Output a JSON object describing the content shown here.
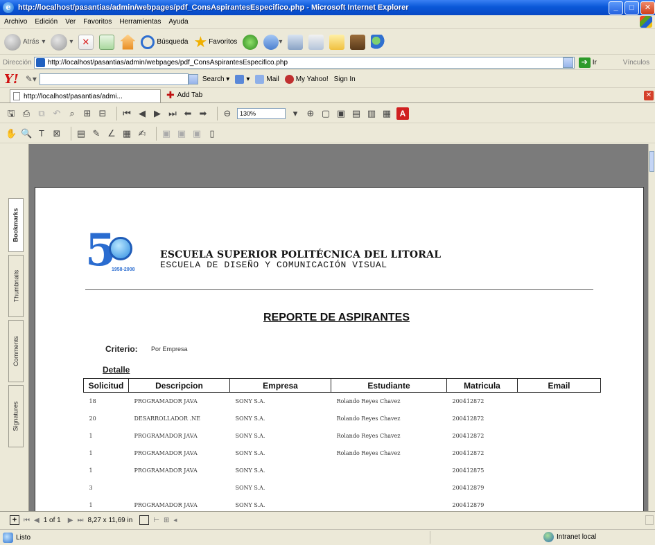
{
  "window": {
    "title": "http://localhost/pasantias/admin/webpages/pdf_ConsAspirantesEspecifico.php - Microsoft Internet Explorer"
  },
  "menu": [
    "Archivo",
    "Edición",
    "Ver",
    "Favoritos",
    "Herramientas",
    "Ayuda"
  ],
  "toolbar": {
    "back": "Atrás",
    "search": "Búsqueda",
    "favorites": "Favoritos"
  },
  "address": {
    "label": "Dirección",
    "url": "http://localhost/pasantias/admin/webpages/pdf_ConsAspirantesEspecifico.php",
    "go": "Ir",
    "links": "Vínculos"
  },
  "yahoo": {
    "logo": "Y!",
    "search": "Search",
    "mail": "Mail",
    "my_yahoo": "My Yahoo!",
    "sign_in": "Sign In"
  },
  "tabs": {
    "active": "http://localhost/pasantias/admi...",
    "add": "Add Tab"
  },
  "acrobat": {
    "zoom": "130%"
  },
  "side_tabs": [
    "Bookmarks",
    "Thumbnails",
    "Comments",
    "Signatures"
  ],
  "document": {
    "logo_year": "1958-2008",
    "institution": "ESCUELA SUPERIOR POLITÉCNICA DEL LITORAL",
    "school": "ESCUELA DE DISEÑO Y COMUNICACIÓN VISUAL",
    "report_title": "REPORTE DE ASPIRANTES",
    "criterio_label": "Criterio:",
    "criterio_value": "Por Empresa",
    "detalle_label": "Detalle",
    "columns": [
      "Solicitud",
      "Descripcion",
      "Empresa",
      "Estudiante",
      "Matricula",
      "Email"
    ],
    "rows": [
      [
        "18",
        "PROGRAMADOR JAVA",
        "SONY S.A.",
        "Rolando Reyes Chavez",
        "200412872",
        ""
      ],
      [
        "20",
        "DESARROLLADOR .NE",
        "SONY S.A.",
        "Rolando Reyes Chavez",
        "200412872",
        ""
      ],
      [
        "1",
        "PROGRAMADOR JAVA",
        "SONY S.A.",
        "Rolando Reyes Chavez",
        "200412872",
        ""
      ],
      [
        "1",
        "PROGRAMADOR JAVA",
        "SONY S.A.",
        "Rolando Reyes Chavez",
        "200412872",
        ""
      ],
      [
        "1",
        "PROGRAMADOR JAVA",
        "SONY S.A.",
        "",
        "200412875",
        ""
      ],
      [
        "3",
        "",
        "SONY S.A.",
        "",
        "200412879",
        ""
      ],
      [
        "1",
        "PROGRAMADOR JAVA",
        "SONY S.A.",
        "",
        "200412879",
        ""
      ]
    ]
  },
  "nav": {
    "page": "1 of 1",
    "size": "8,27 x 11,69 in"
  },
  "status": {
    "text": "Listo",
    "zone": "Intranet local"
  }
}
